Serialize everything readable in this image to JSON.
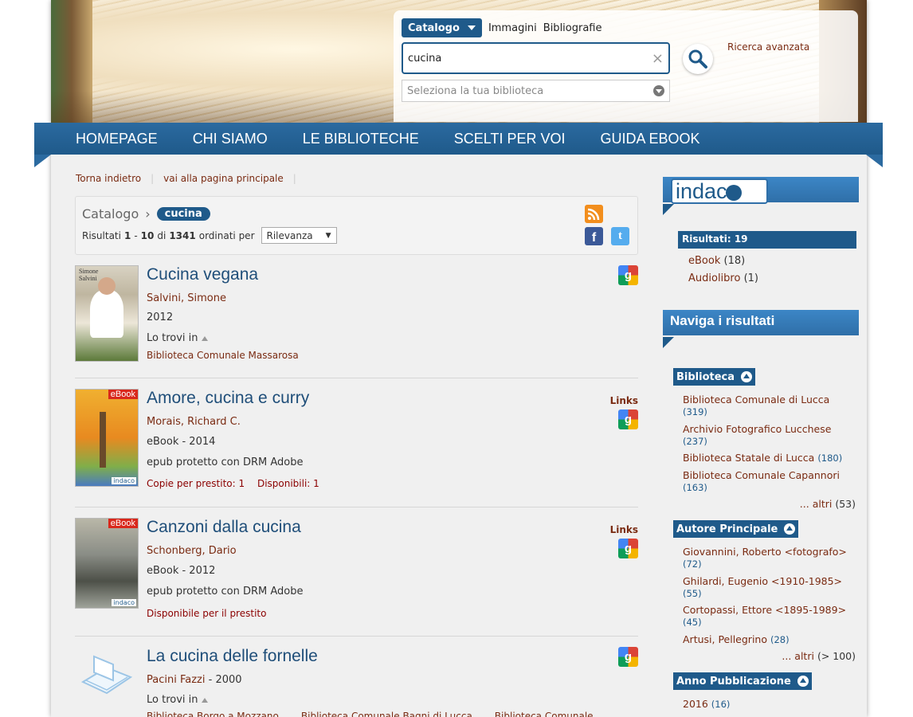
{
  "search": {
    "tabs": [
      "Catalogo",
      "Immagini",
      "Bibliografie"
    ],
    "query": "cucina",
    "library_placeholder": "Seleziona la tua biblioteca",
    "advanced_label": "Ricerca avanzata"
  },
  "nav": [
    "HOMEPAGE",
    "CHI SIAMO",
    "LE BIBLIOTECHE",
    "SCELTI PER VOI",
    "GUIDA EBOOK"
  ],
  "breadcrumbs": [
    "Torna indietro",
    "vai alla pagina principale"
  ],
  "header": {
    "catalog_label": "Catalogo",
    "query_chip": "cucina",
    "results_prefix": "Risultati",
    "range_from": "1",
    "range_to": "10",
    "of_label": "di",
    "total": "1341",
    "sorted_label": "ordinati per",
    "sort_value": "Rilevanza"
  },
  "results": [
    {
      "title": "Cucina vegana",
      "author": "Salvini, Simone",
      "year": "2012",
      "found_label": "Lo trovi in",
      "libraries": [
        "Biblioteca Comunale Massarosa"
      ]
    },
    {
      "title": "Amore, cucina e curry",
      "author": "Morais, Richard C.",
      "type_year": "eBook - 2014",
      "format": "epub protetto con DRM Adobe",
      "copies": "Copie per prestito: 1",
      "available": "Disponibili: 1",
      "links_label": "Links",
      "cover_tag": "eBook",
      "cover_brand": "indaco"
    },
    {
      "title": "Canzoni dalla cucina",
      "author": "Schonberg, Dario",
      "type_year": "eBook - 2012",
      "format": "epub protetto con DRM Adobe",
      "available": "Disponibile per il prestito",
      "links_label": "Links",
      "cover_tag": "eBook",
      "cover_brand": "indaco"
    },
    {
      "title": "La cucina delle fornelle",
      "author": "Pacini Fazzi",
      "year_suffix": " - 2000",
      "found_label": "Lo trovi in",
      "libraries": [
        "Biblioteca Borgo a Mozzano",
        "Biblioteca Comunale Bagni di Lucca",
        "Biblioteca Comunale"
      ]
    }
  ],
  "sidebar": {
    "logo_text": "indac",
    "results_label": "Risultati: 19",
    "formats": [
      {
        "label": "eBook",
        "count": "(18)"
      },
      {
        "label": "Audiolibro",
        "count": "(1)"
      }
    ],
    "naviga_title": "Naviga i risultati",
    "facets": [
      {
        "title": "Biblioteca",
        "items": [
          {
            "label": "Biblioteca Comunale di Lucca",
            "count": "(319)"
          },
          {
            "label": "Archivio Fotografico Lucchese",
            "count": "(237)"
          },
          {
            "label": "Biblioteca Statale di Lucca",
            "count": "(180)"
          },
          {
            "label": "Biblioteca Comunale Capannori",
            "count": "(163)"
          }
        ],
        "more": "... altri",
        "more_count": "(53)"
      },
      {
        "title": "Autore Principale",
        "items": [
          {
            "label": "Giovannini, Roberto <fotografo>",
            "count": "(72)"
          },
          {
            "label": "Ghilardi, Eugenio <1910-1985>",
            "count": "(55)"
          },
          {
            "label": "Cortopassi, Ettore <1895-1989>",
            "count": "(45)"
          },
          {
            "label": "Artusi, Pellegrino",
            "count": "(28)"
          }
        ],
        "more": "... altri",
        "more_count": "(> 100)"
      },
      {
        "title": "Anno Pubblicazione",
        "items": [
          {
            "label": "2016",
            "count": "(16)"
          }
        ]
      }
    ]
  }
}
